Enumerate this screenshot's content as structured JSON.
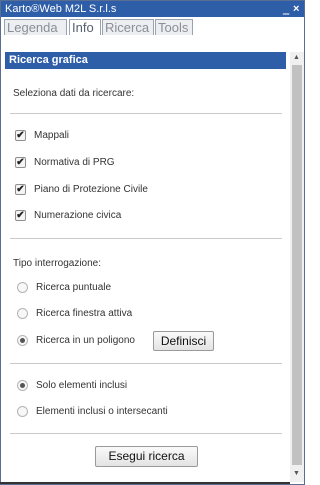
{
  "window": {
    "title": "Karto®Web M2L S.r.l.s",
    "minimize_glyph": "‗",
    "close_glyph": "×"
  },
  "tabs": [
    {
      "label": "Legenda",
      "active": false
    },
    {
      "label": "Info",
      "active": true
    },
    {
      "label": "Ricerca",
      "active": false
    },
    {
      "label": "Tools",
      "active": false
    }
  ],
  "panel": {
    "header": "Ricerca grafica",
    "select_label": "Seleziona dati da ricercare:",
    "checkboxes": [
      {
        "label": "Mappali",
        "checked": true
      },
      {
        "label": "Normativa di PRG",
        "checked": true
      },
      {
        "label": "Piano di Protezione Civile",
        "checked": true
      },
      {
        "label": "Numerazione civica",
        "checked": true
      }
    ],
    "query_type_label": "Tipo interrogazione:",
    "query_types": [
      {
        "label": "Ricerca puntuale",
        "checked": false
      },
      {
        "label": "Ricerca finestra attiva",
        "checked": false
      },
      {
        "label": "Ricerca in un poligono",
        "checked": true
      }
    ],
    "define_button": "Definisci",
    "inclusion": [
      {
        "label": "Solo elementi inclusi",
        "checked": true
      },
      {
        "label": "Elementi inclusi o intersecanti",
        "checked": false
      }
    ],
    "run_button": "Esegui ricerca"
  },
  "colors": {
    "titlebar": "#2f5ea8",
    "header": "#2f5ea8"
  },
  "icons": {
    "minimize": "minimize-icon",
    "close": "close-icon",
    "scroll_up": "scroll-up-arrow-icon",
    "scroll_down": "scroll-down-arrow-icon"
  }
}
